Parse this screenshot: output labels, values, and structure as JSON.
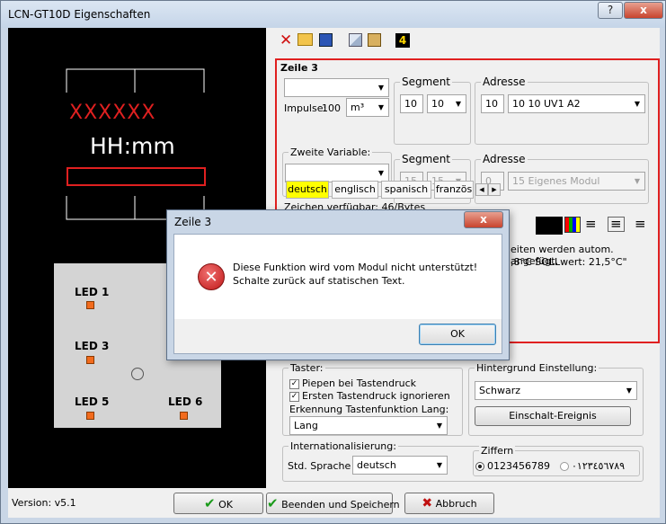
{
  "window": {
    "title": "LCN-GT10D Eigenschaften",
    "help_label": "?",
    "close_label": "x"
  },
  "preview": {
    "time_text": "HH:mm",
    "crosses": "XXXXXX",
    "leds": [
      {
        "label": "LED 1"
      },
      {
        "label": "LED 3"
      },
      {
        "label": "LED 5"
      },
      {
        "label": "LED 6"
      }
    ]
  },
  "toolbar": {
    "badge": "4"
  },
  "zeile": {
    "title": "Zeile 3",
    "variable_value": "",
    "impulse_label": "Impulse:",
    "impulse_value": "100",
    "impulse_unit": "m³",
    "segment_label": "Segment",
    "segment_value": "10",
    "segment_select": "10",
    "adresse_label": "Adresse",
    "adresse_value": "10",
    "adresse_select": "10  10  UV1 A2",
    "zweite_label": "Zweite Variable:",
    "zweite_value": "",
    "segment2_label": "Segment",
    "segment2_value": "15",
    "segment2_select": "15",
    "adresse2_label": "Adresse",
    "adresse2_value": "0",
    "adresse2_select": "15  Eigenes Modul",
    "tabs": [
      "deutsch",
      "englisch",
      "spanisch",
      "französ"
    ],
    "zeichen_text": "Zeichen verfügbar: 46/Bytes",
    "hint_line1": "eiten werden autom. angefügt.",
    "hint_line2": ",8°C SOLLwert: 21,5°C\""
  },
  "taster": {
    "title": "Taster:",
    "piepen": "Piepen bei Tastendruck",
    "ersten": "Ersten Tastendruck ignorieren",
    "erkennung": "Erkennung Tastenfunktion Lang:",
    "lang_value": "Lang"
  },
  "hintergrund": {
    "title": "Hintergrund Einstellung:",
    "value": "Schwarz",
    "button": "Einschalt-Ereignis"
  },
  "intl": {
    "title": "Internationalisierung:",
    "sprache_label": "Std. Sprache",
    "sprache_value": "deutsch"
  },
  "ziffern": {
    "title": "Ziffern",
    "option1": "0123456789",
    "option2": "٠١٢٣٤٥٦٧٨٩"
  },
  "footer": {
    "version": "Version: v5.1",
    "ok": "OK",
    "beenden": "Beenden und Speichern",
    "abbruch": "Abbruch"
  },
  "dialog": {
    "title": "Zeile 3",
    "message1": "Diese Funktion wird vom Modul nicht unterstützt!",
    "message2": "Schalte zurück auf statischen Text.",
    "ok": "OK",
    "close": "x"
  }
}
